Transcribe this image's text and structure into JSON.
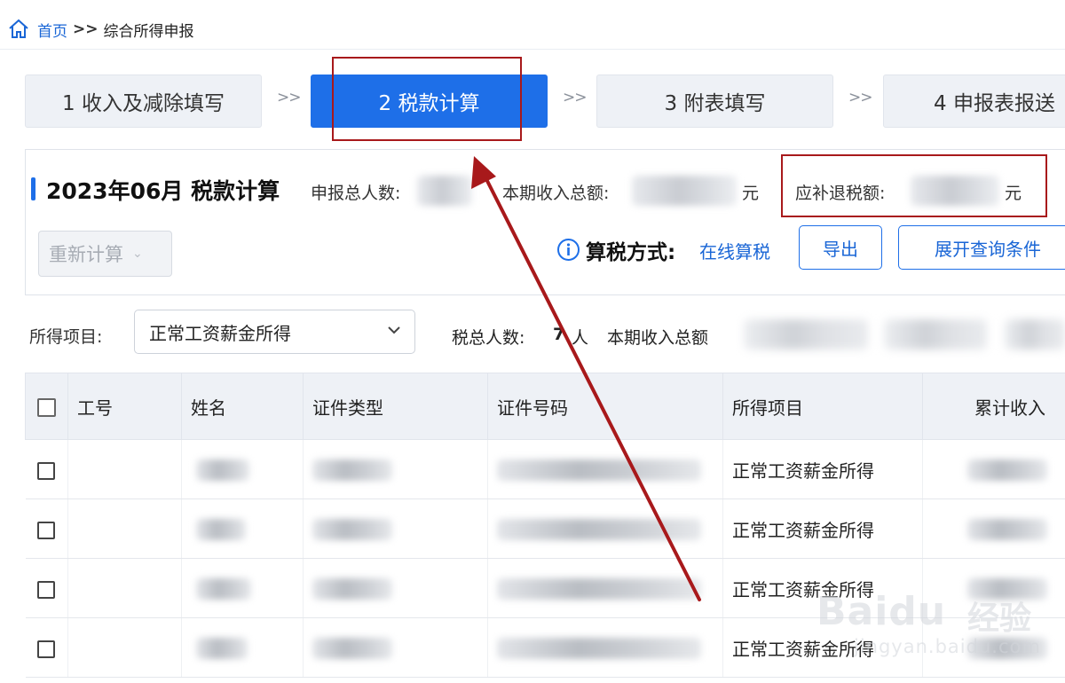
{
  "breadcrumb": {
    "home_icon": "home-icon",
    "home": "首页",
    "separator": ">>",
    "current": "综合所得申报"
  },
  "steps": [
    {
      "label": "1 收入及减除填写",
      "active": false
    },
    {
      "label": "2 税款计算",
      "active": true
    },
    {
      "label": "3 附表填写",
      "active": false
    },
    {
      "label": "4 申报表报送",
      "active": false
    }
  ],
  "step_separator": ">>",
  "panel": {
    "title": "2023年06月  税款计算",
    "stat_people_label": "申报总人数:",
    "stat_income_label": "本期收入总额:",
    "stat_income_unit": "元",
    "stat_tax_label": "应补退税额:",
    "stat_tax_unit": "元",
    "recalc_label": "重新计算",
    "method_label": "算税方式:",
    "method_value": "在线算税",
    "export_label": "导出",
    "expand_label": "展开查询条件"
  },
  "filter": {
    "income_item_label": "所得项目:",
    "income_item_value": "正常工资薪金所得",
    "summary_people": "税总人数:",
    "summary_people_value": "7",
    "summary_people_unit": "人",
    "summary_income": "本期收入总额"
  },
  "table": {
    "headers": [
      "工号",
      "姓名",
      "证件类型",
      "证件号码",
      "所得项目",
      "累计收入"
    ],
    "rows": [
      {
        "income_item": "正常工资薪金所得"
      },
      {
        "income_item": "正常工资薪金所得"
      },
      {
        "income_item": "正常工资薪金所得"
      },
      {
        "income_item": "正常工资薪金所得"
      }
    ]
  },
  "watermark": {
    "brand": "Baidu",
    "suffix": "经验",
    "url": "jingyan.baidu.com"
  },
  "colors": {
    "primary": "#1e6fe8",
    "link": "#1a66d6",
    "annotation_red": "#a8191b",
    "step_inactive_bg": "#eef1f6"
  }
}
